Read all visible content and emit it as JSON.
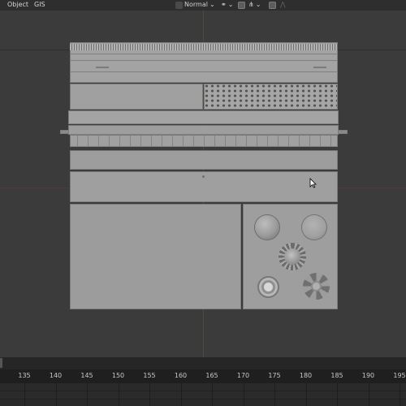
{
  "header": {
    "menu": [
      "Object",
      "GIS"
    ],
    "transform_orientation": "Normal",
    "icons": [
      "pivot-icon",
      "snap-icon",
      "proportional-edit-icon",
      "overlay-icon",
      "shading-icon"
    ]
  },
  "viewport": {
    "knob_icons": [
      "knob-plain-icon",
      "knob-flat-icon",
      "knob-ribbed-icon",
      "knob-ringed-icon",
      "knob-hex-icon"
    ],
    "cursor": "arrow-cursor-icon"
  },
  "timeline": {
    "frames": [
      "135",
      "140",
      "145",
      "150",
      "155",
      "160",
      "165",
      "170",
      "175",
      "180",
      "185",
      "190",
      "195"
    ]
  },
  "colors": {
    "background": "#2b2b2b",
    "viewport": "#3b3b3b",
    "mesh": "#9e9e9e"
  }
}
